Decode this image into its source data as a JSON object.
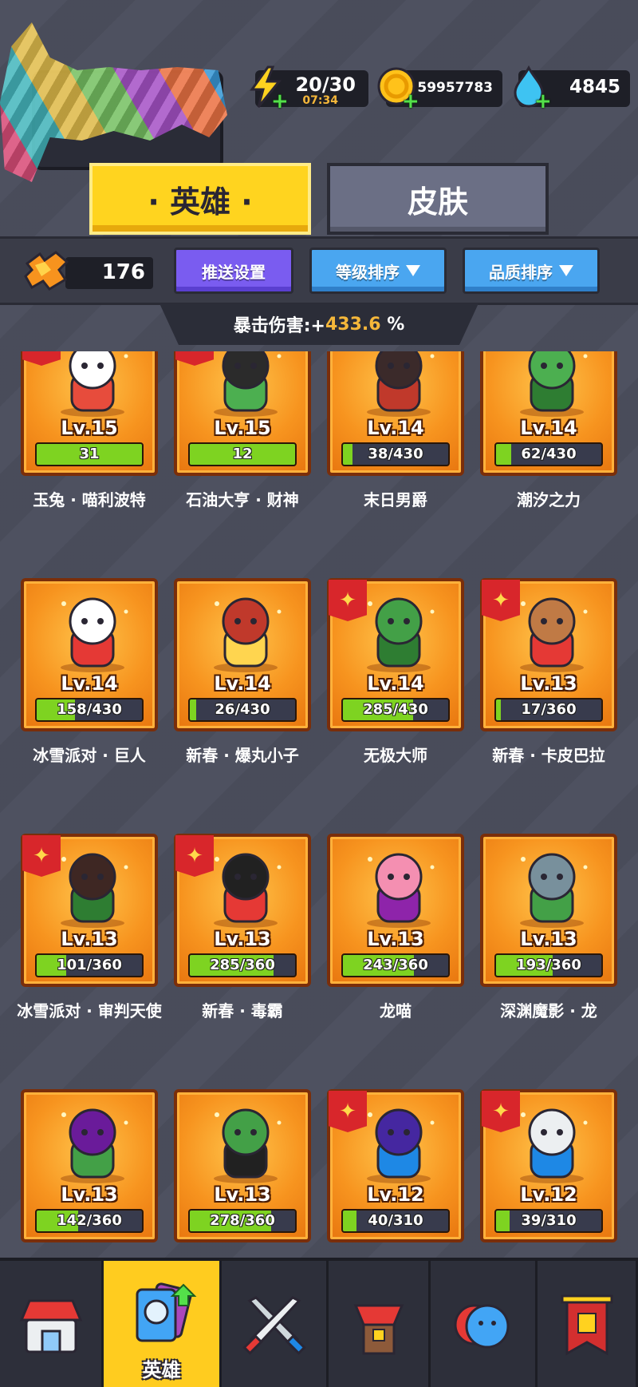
{
  "resources": {
    "energy": "20/30",
    "energy_timer": "07:34",
    "gold": "59957783",
    "gems": "4845"
  },
  "tabs": [
    {
      "label": "· 英雄 ·",
      "active": true
    },
    {
      "label": "皮肤",
      "active": false
    }
  ],
  "toolbar": {
    "shard_count": "176",
    "push_settings": "推送设置",
    "sort_level": "等级排序",
    "sort_quality": "品质排序"
  },
  "crit": {
    "label": "暴击伤害:+",
    "value": "433.6",
    "unit": "%"
  },
  "heroes": [
    {
      "name": "玉兔 · 喵利波特",
      "level": "Lv.15",
      "progress_text": "31",
      "progress": 1.0,
      "badge": true,
      "icon": "bunny-hero-icon"
    },
    {
      "name": "石油大亨 · 财神",
      "level": "Lv.15",
      "progress_text": "12",
      "progress": 1.0,
      "badge": true,
      "icon": "oil-tycoon-hero-icon"
    },
    {
      "name": "末日男爵",
      "level": "Lv.14",
      "progress_text": "38/430",
      "progress": 0.088,
      "badge": false,
      "icon": "doom-baron-hero-icon"
    },
    {
      "name": "潮汐之力",
      "level": "Lv.14",
      "progress_text": "62/430",
      "progress": 0.144,
      "badge": false,
      "icon": "tide-croc-hero-icon"
    },
    {
      "name": "冰雪派对 · 巨人",
      "level": "Lv.14",
      "progress_text": "158/430",
      "progress": 0.367,
      "badge": false,
      "icon": "snow-giant-hero-icon"
    },
    {
      "name": "新春 · 爆丸小子",
      "level": "Lv.14",
      "progress_text": "26/430",
      "progress": 0.06,
      "badge": false,
      "icon": "firecracker-kid-hero-icon"
    },
    {
      "name": "无极大师",
      "level": "Lv.14",
      "progress_text": "285/430",
      "progress": 0.663,
      "badge": true,
      "icon": "orc-master-hero-icon"
    },
    {
      "name": "新春 · 卡皮巴拉",
      "level": "Lv.13",
      "progress_text": "17/360",
      "progress": 0.047,
      "badge": true,
      "icon": "capybara-hero-icon"
    },
    {
      "name": "冰雪派对 · 审判天使",
      "level": "Lv.13",
      "progress_text": "101/360",
      "progress": 0.281,
      "badge": true,
      "icon": "judgment-angel-hero-icon"
    },
    {
      "name": "新春 · 毒霸",
      "level": "Lv.13",
      "progress_text": "285/360",
      "progress": 0.792,
      "badge": true,
      "icon": "poison-blob-hero-icon"
    },
    {
      "name": "龙喵",
      "level": "Lv.13",
      "progress_text": "243/360",
      "progress": 0.675,
      "badge": false,
      "icon": "dragon-cat-hero-icon"
    },
    {
      "name": "深渊魔影 · 龙",
      "level": "Lv.13",
      "progress_text": "193/360",
      "progress": 0.536,
      "badge": false,
      "icon": "abyss-dragon-hero-icon"
    },
    {
      "name": "",
      "level": "Lv.13",
      "progress_text": "142/360",
      "progress": 0.394,
      "badge": false,
      "icon": "goblin-shaman-hero-icon"
    },
    {
      "name": "",
      "level": "Lv.13",
      "progress_text": "278/360",
      "progress": 0.772,
      "badge": false,
      "icon": "frog-magician-hero-icon"
    },
    {
      "name": "",
      "level": "Lv.12",
      "progress_text": "40/310",
      "progress": 0.129,
      "badge": true,
      "icon": "dark-sorceress-hero-icon"
    },
    {
      "name": "",
      "level": "Lv.12",
      "progress_text": "39/310",
      "progress": 0.126,
      "badge": true,
      "icon": "white-knight-hero-icon"
    }
  ],
  "nav": [
    {
      "label": "",
      "icon": "shop-icon",
      "active": false
    },
    {
      "label": "英雄",
      "icon": "hero-cards-icon",
      "active": true
    },
    {
      "label": "",
      "icon": "battle-swords-icon",
      "active": false
    },
    {
      "label": "",
      "icon": "chest-icon",
      "active": false
    },
    {
      "label": "",
      "icon": "social-icon",
      "active": false
    },
    {
      "label": "",
      "icon": "guild-banner-icon",
      "active": false
    }
  ]
}
